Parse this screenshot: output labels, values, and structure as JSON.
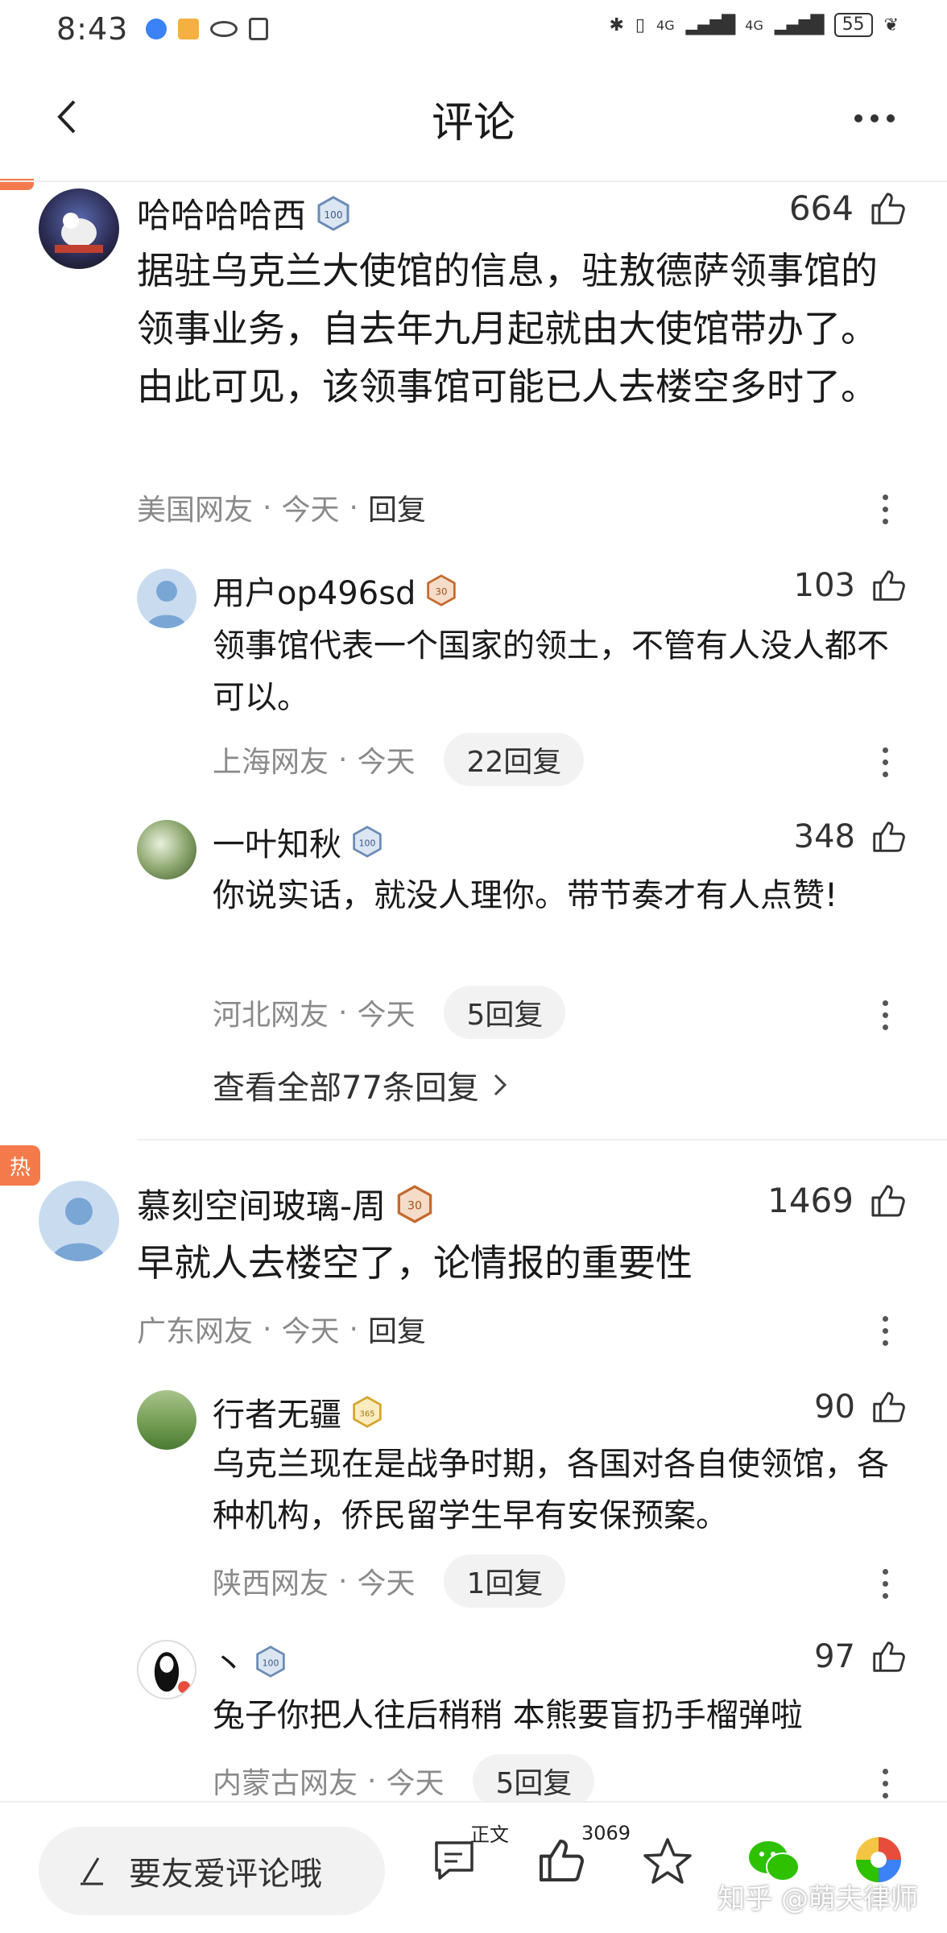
{
  "status_bar": {
    "time": "8:43",
    "battery": "55",
    "network_1": "4G",
    "network_2": "4G"
  },
  "header": {
    "title": "评论"
  },
  "comments": [
    {
      "username": "哈哈哈哈西",
      "level": "100",
      "likes": "664",
      "content": "据驻乌克兰大使馆的信息，驻敖德萨领事馆的领事业务，自去年九月起就由大使馆带办了。由此可见，该领事馆可能已人去楼空多时了。",
      "location": "美国网友",
      "time": "今天",
      "reply": "回复",
      "replies": [
        {
          "username": "用户op496sd",
          "level": "30",
          "likes": "103",
          "content": "领事馆代表一个国家的领土，不管有人没人都不可以。",
          "location": "上海网友",
          "time": "今天",
          "reply_count": "22回复"
        },
        {
          "username": "一叶知秋",
          "level": "100",
          "likes": "348",
          "content": "你说实话，就没人理你。带节奏才有人点赞!",
          "location": "河北网友",
          "time": "今天",
          "reply_count": "5回复"
        }
      ],
      "view_all": "查看全部77条回复"
    },
    {
      "hot": "热",
      "username": "慕刻空间玻璃-周",
      "level": "30",
      "likes": "1469",
      "content": "早就人去楼空了，论情报的重要性",
      "location": "广东网友",
      "time": "今天",
      "reply": "回复",
      "replies": [
        {
          "username": "行者无疆",
          "level": "365",
          "likes": "90",
          "content": "乌克兰现在是战争时期，各国对各自使领馆，各种机构，侨民留学生早有安保预案。",
          "location": "陕西网友",
          "time": "今天",
          "reply_count": "1回复"
        },
        {
          "username": "丶",
          "level": "100",
          "likes": "97",
          "content": "兔子你把人往后稍稍 本熊要盲扔手榴弹啦",
          "location": "内蒙古网友",
          "time": "今天",
          "reply_count": "5回复"
        }
      ]
    }
  ],
  "bottom_bar": {
    "input_placeholder": "要友爱评论哦",
    "article_label": "正文",
    "like_count": "3069",
    "watermark": "知乎 @萌夫律师"
  },
  "colors": {
    "accent_orange": "#f47a4b",
    "text_primary": "#1a1a1a",
    "text_secondary": "#8a8a8a",
    "pill_bg": "#f2f2f2"
  }
}
